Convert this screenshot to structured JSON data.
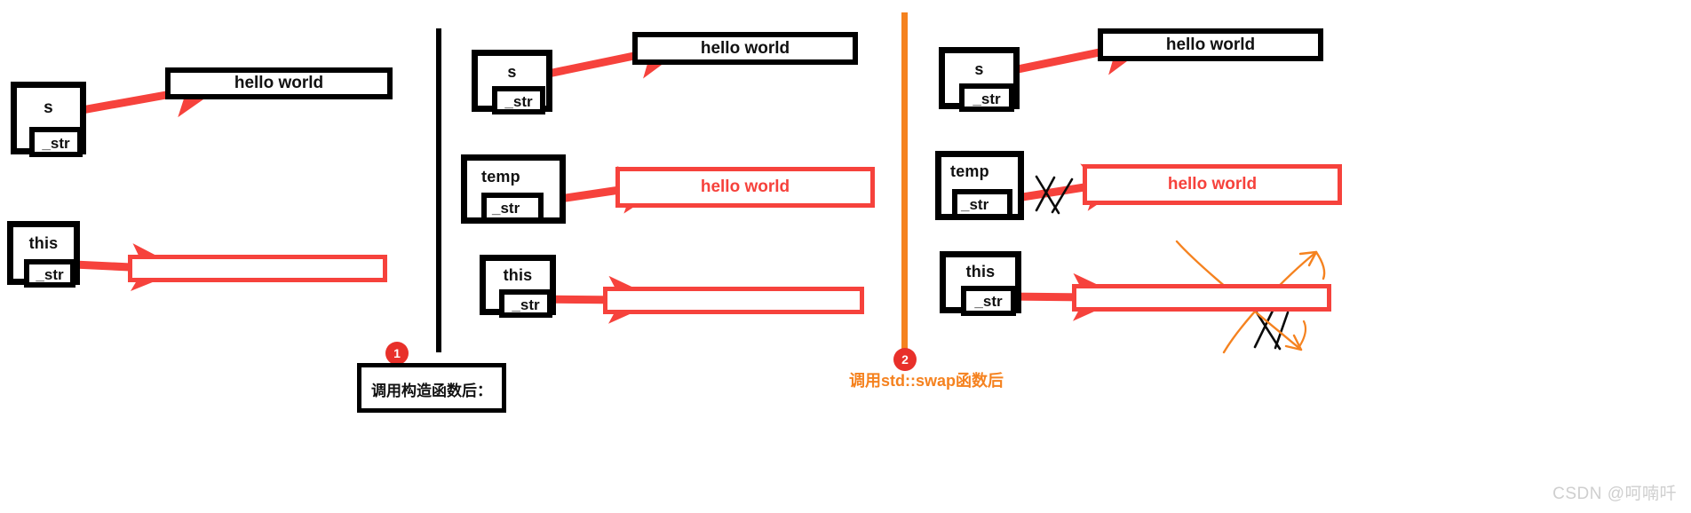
{
  "diagram": {
    "title_visible": false,
    "colors": {
      "black": "#000000",
      "red": "#f6423c",
      "orange": "#f5821f",
      "badge_red": "#e8302a",
      "watermark_gray": "#cfcfcf",
      "background": "#ffffff"
    }
  },
  "panels": [
    {
      "id": "panel-initial",
      "caption": "",
      "badge": "",
      "divider": "none",
      "boxes": [
        {
          "id": "s",
          "var_label": "s",
          "inner_label": "_str"
        },
        {
          "id": "this",
          "var_label": "this",
          "inner_label": "_str"
        }
      ],
      "heap_blocks": [
        {
          "id": "s-heap",
          "text": "hello world",
          "style": "black"
        },
        {
          "id": "this-heap",
          "text": "",
          "style": "empty-red"
        }
      ],
      "arrows": [
        {
          "from": "s._str",
          "to": "s-heap",
          "color": "#f6423c",
          "crossed": false
        },
        {
          "from": "this._str",
          "to": "this-heap",
          "color": "#f6423c",
          "crossed": false
        }
      ]
    },
    {
      "id": "panel-after-constructor",
      "caption": "调用构造函数后：",
      "badge": "1",
      "divider": "black",
      "boxes": [
        {
          "id": "s",
          "var_label": "s",
          "inner_label": "_str"
        },
        {
          "id": "temp",
          "var_label": "temp",
          "inner_label": "_str"
        },
        {
          "id": "this",
          "var_label": "this",
          "inner_label": "_str"
        }
      ],
      "heap_blocks": [
        {
          "id": "s-heap",
          "text": "hello world",
          "style": "black"
        },
        {
          "id": "temp-heap",
          "text": "hello world",
          "style": "red"
        },
        {
          "id": "this-heap",
          "text": "",
          "style": "empty-red"
        }
      ],
      "arrows": [
        {
          "from": "s._str",
          "to": "s-heap",
          "color": "#f6423c",
          "crossed": false
        },
        {
          "from": "temp._str",
          "to": "temp-heap",
          "color": "#f6423c",
          "crossed": false
        },
        {
          "from": "this._str",
          "to": "this-heap",
          "color": "#f6423c",
          "crossed": false
        }
      ]
    },
    {
      "id": "panel-after-swap",
      "caption": "调用std::swap函数后",
      "badge": "2",
      "divider": "orange",
      "boxes": [
        {
          "id": "s",
          "var_label": "s",
          "inner_label": "_str"
        },
        {
          "id": "temp",
          "var_label": "temp",
          "inner_label": "_str"
        },
        {
          "id": "this",
          "var_label": "this",
          "inner_label": "_str"
        }
      ],
      "heap_blocks": [
        {
          "id": "s-heap",
          "text": "hello world",
          "style": "black"
        },
        {
          "id": "temp-heap",
          "text": "hello world",
          "style": "red"
        },
        {
          "id": "this-heap",
          "text": "",
          "style": "empty-red"
        }
      ],
      "arrows": [
        {
          "from": "s._str",
          "to": "s-heap",
          "color": "#f6423c",
          "crossed": false
        },
        {
          "from": "temp._str",
          "to": "temp-heap",
          "color": "#f6423c",
          "crossed": true
        },
        {
          "from": "this._str",
          "to": "this-heap",
          "color": "#f6423c",
          "crossed": true
        },
        {
          "from": "temp._str",
          "to": "this-heap",
          "color": "#f5821f",
          "crossed": false
        },
        {
          "from": "this._str",
          "to": "temp-heap",
          "color": "#f5821f",
          "crossed": false
        }
      ]
    }
  ],
  "labels": {
    "s": "s",
    "temp": "temp",
    "this": "this",
    "str": "_str",
    "hello_world": "hello world",
    "empty": ""
  },
  "captions": {
    "step1": "调用构造函数后：",
    "step1_badge": "1",
    "step2": "调用std::swap函数后",
    "step2_badge": "2"
  },
  "watermark": "CSDN @呵喃吀"
}
